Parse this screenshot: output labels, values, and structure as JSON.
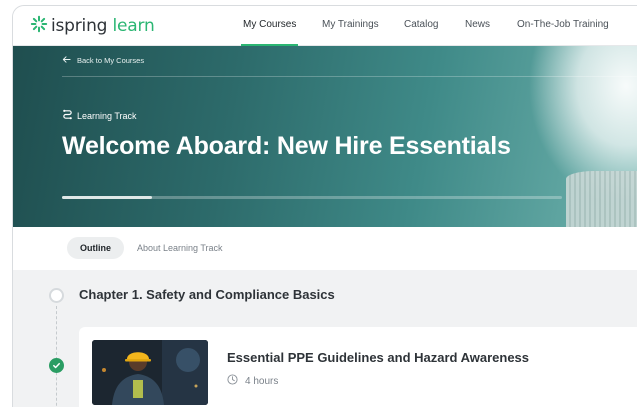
{
  "app": {
    "logo_prefix": "ispring",
    "logo_suffix": " learn",
    "brand_color": "#2bb673"
  },
  "nav": {
    "items": [
      {
        "label": "My Courses",
        "active": true
      },
      {
        "label": "My Trainings",
        "active": false
      },
      {
        "label": "Catalog",
        "active": false
      },
      {
        "label": "News",
        "active": false
      },
      {
        "label": "On-The-Job Training",
        "active": false
      }
    ]
  },
  "hero": {
    "back_label": "Back to My Courses",
    "type_label": "Learning Track",
    "title": "Welcome Aboard: New Hire Essentials",
    "progress": 0.18
  },
  "tabs": {
    "outline": "Outline",
    "about": "About Learning Track"
  },
  "chapter": {
    "title": "Chapter 1. Safety and Compliance Basics"
  },
  "course": {
    "title": "Essential PPE Guidelines and Hazard Awareness",
    "duration": "4 hours",
    "status": "completed",
    "status_color": "#2a9d63"
  },
  "icons": {
    "logo": "spark-icon",
    "back": "arrow-left-icon",
    "track": "route-icon",
    "done": "check-icon",
    "time": "clock-icon"
  }
}
